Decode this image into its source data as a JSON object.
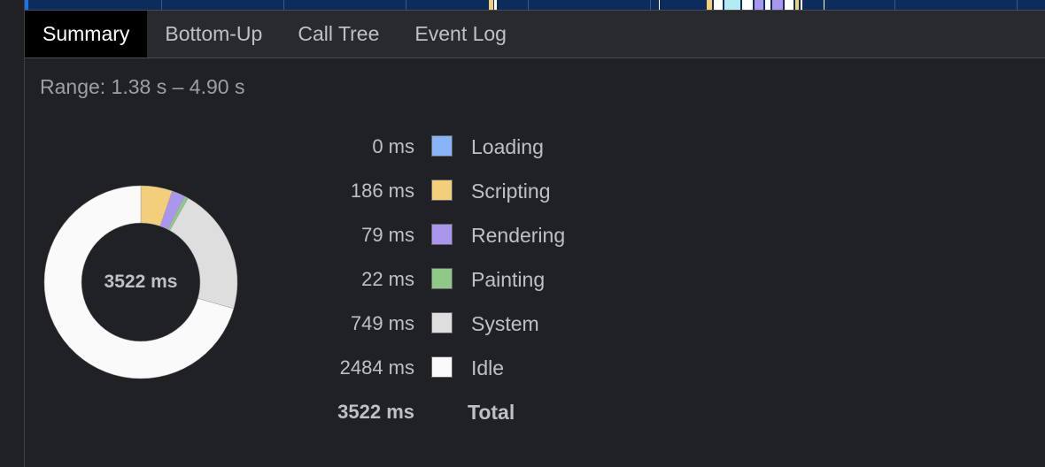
{
  "tabs": [
    {
      "label": "Summary",
      "active": true
    },
    {
      "label": "Bottom-Up",
      "active": false
    },
    {
      "label": "Call Tree",
      "active": false
    },
    {
      "label": "Event Log",
      "active": false
    }
  ],
  "range_text": "Range: 1.38 s – 4.90 s",
  "summary": {
    "total_label": "Total",
    "total_value": "3522 ms",
    "total_ms": 3522,
    "categories": [
      {
        "name": "Loading",
        "value": "0 ms",
        "ms": 0,
        "color": "#8ab4f8"
      },
      {
        "name": "Scripting",
        "value": "186 ms",
        "ms": 186,
        "color": "#f3cf7b"
      },
      {
        "name": "Rendering",
        "value": "79 ms",
        "ms": 79,
        "color": "#ab96ee"
      },
      {
        "name": "Painting",
        "value": "22 ms",
        "ms": 22,
        "color": "#8fc887"
      },
      {
        "name": "System",
        "value": "749 ms",
        "ms": 749,
        "color": "#dedede"
      },
      {
        "name": "Idle",
        "value": "2484 ms",
        "ms": 2484,
        "color": "#fafafa"
      }
    ]
  },
  "colors": {
    "background": "#202124",
    "tabbar": "#292a2d",
    "active_tab": "#000000",
    "timeline": "#0c2d5c"
  }
}
